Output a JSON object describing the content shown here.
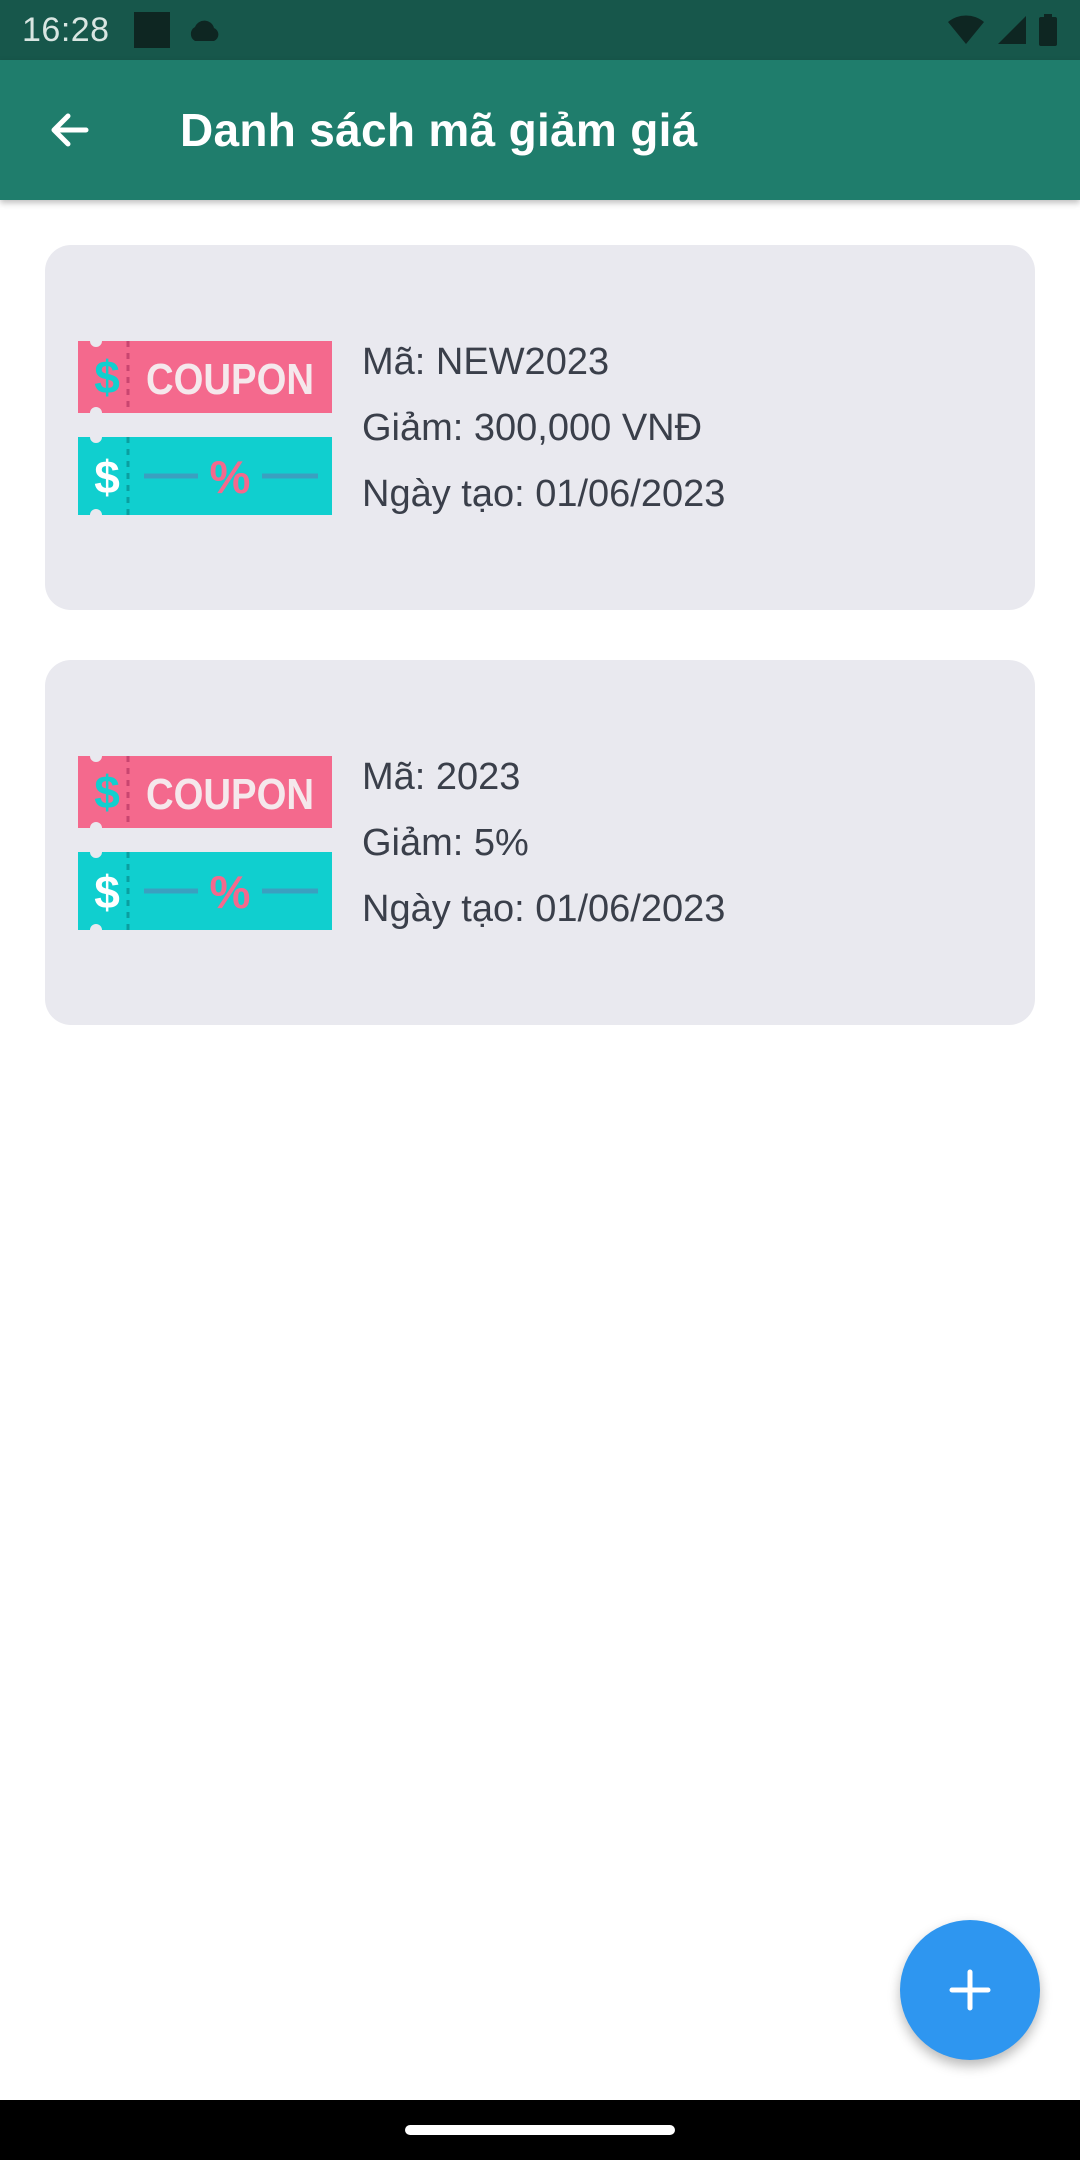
{
  "status_bar": {
    "time": "16:28",
    "icons": [
      "notification-square-icon",
      "cloud-icon",
      "wifi-icon",
      "signal-icon",
      "battery-icon"
    ]
  },
  "app_bar": {
    "title": "Danh sách mã giảm giá",
    "back_icon": "arrow-back-icon",
    "background": "#1f7d6c"
  },
  "coupons": [
    {
      "code_text": "Mã: NEW2023",
      "discount_text": "Giảm: 300,000 VNĐ",
      "created_text": "Ngày tạo: 01/06/2023",
      "image_label": "COUPON",
      "image_top_symbol": "$",
      "image_bottom_symbol": "%"
    },
    {
      "code_text": "Mã: 2023",
      "discount_text": "Giảm: 5%",
      "created_text": "Ngày tạo: 01/06/2023",
      "image_label": "COUPON",
      "image_top_symbol": "$",
      "image_bottom_symbol": "%"
    }
  ],
  "fab": {
    "icon": "plus-icon",
    "color": "#2e96f0"
  },
  "colors": {
    "coupon_pink": "#f4698d",
    "coupon_teal": "#10cfcf",
    "card_bg": "#e9e9ef"
  }
}
